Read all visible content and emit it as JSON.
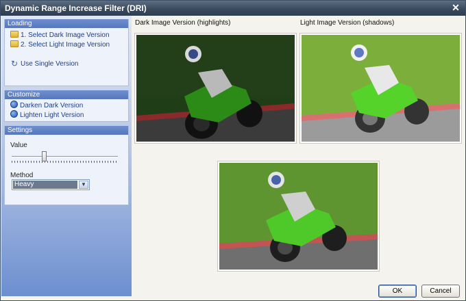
{
  "window": {
    "title": "Dynamic Range Increase Filter (DRI)",
    "close_glyph": "✕"
  },
  "sidebar": {
    "loading": {
      "header": "Loading",
      "items": [
        {
          "label": "1. Select Dark Image Version",
          "icon": "folder-icon"
        },
        {
          "label": "2. Select Light Image Version",
          "icon": "folder-icon"
        },
        {
          "label": "Use Single Version",
          "icon": "refresh-icon"
        }
      ]
    },
    "customize": {
      "header": "Customize",
      "items": [
        {
          "label": "Darken Dark Version",
          "icon": "darken-icon"
        },
        {
          "label": "Lighten Light Version",
          "icon": "lighten-icon"
        }
      ]
    },
    "settings": {
      "header": "Settings",
      "value_label": "Value",
      "value_level": 0.3,
      "method_label": "Method",
      "method_value": "Heavy"
    }
  },
  "previews": {
    "dark": {
      "caption": "Dark Image Version (highlights)"
    },
    "light": {
      "caption": "Light Image Version (shadows)"
    },
    "result": {
      "caption": ""
    }
  },
  "buttons": {
    "ok": "OK",
    "cancel": "Cancel"
  },
  "colors": {
    "accent": "#5677bd",
    "title_bar": "#3a4a5f",
    "bike_green": "#4fc82a",
    "grass_dark": "#1f3d17",
    "grass_light": "#7cae3c"
  }
}
